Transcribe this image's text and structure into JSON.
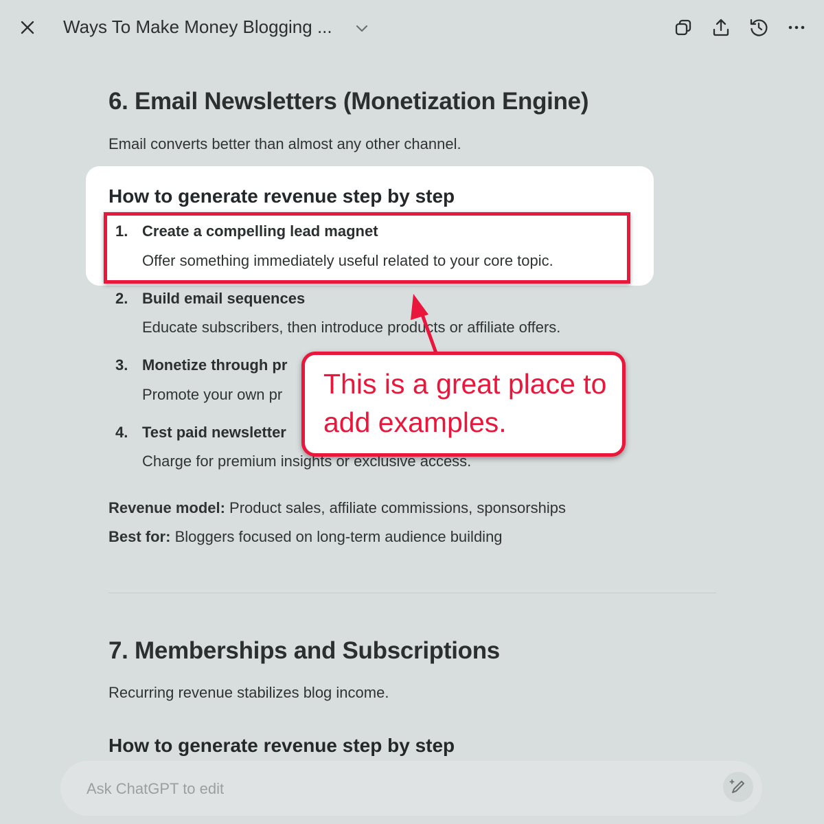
{
  "header": {
    "title": "Ways To Make Money Blogging ...",
    "icons": [
      "close-icon",
      "chevron-down-icon",
      "copy-icon",
      "share-icon",
      "history-icon",
      "more-icon"
    ]
  },
  "section6": {
    "heading": "6. Email Newsletters (Monetization Engine)",
    "intro": "Email converts better than almost any other channel.",
    "subheading": "How to generate revenue step by step",
    "steps": [
      {
        "num": "1.",
        "title": "Create a compelling lead magnet",
        "desc": "Offer something immediately useful related to your core topic."
      },
      {
        "num": "2.",
        "title": "Build email sequences",
        "desc": "Educate subscribers, then introduce products or affiliate offers."
      },
      {
        "num": "3.",
        "title": "Monetize through pr",
        "desc": "Promote your own pr"
      },
      {
        "num": "4.",
        "title": "Test paid newsletter",
        "desc": "Charge for premium insights or exclusive access."
      }
    ],
    "revenue_label": "Revenue model:",
    "revenue_value": " Product sales, affiliate commissions, sponsorships",
    "best_label": "Best for:",
    "best_value": " Bloggers focused on long-term audience building"
  },
  "section7": {
    "heading": "7. Memberships and Subscriptions",
    "intro": "Recurring revenue stabilizes blog income.",
    "subheading": "How to generate revenue step by step"
  },
  "callout": {
    "text": "This is a great place to add examples.",
    "color": "#e8173b"
  },
  "input": {
    "placeholder": "Ask ChatGPT to edit",
    "value": ""
  }
}
